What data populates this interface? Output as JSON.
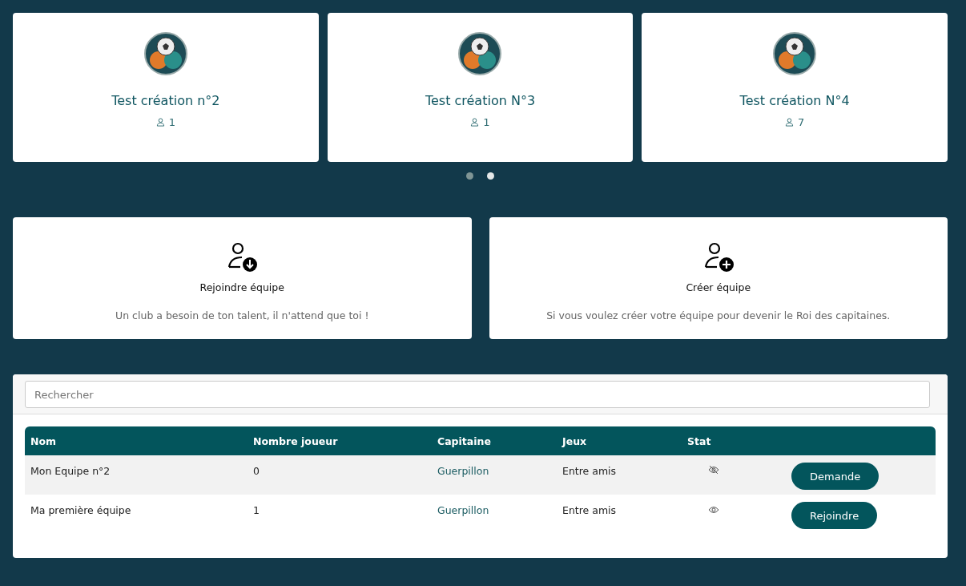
{
  "team_cards": [
    {
      "name": "Test création n°2",
      "members": "1"
    },
    {
      "name": "Test création N°3",
      "members": "1"
    },
    {
      "name": "Test création N°4",
      "members": "7"
    }
  ],
  "carousel_dots": [
    {
      "selected": false
    },
    {
      "selected": true
    }
  ],
  "actions": [
    {
      "kind": "join",
      "title": "Rejoindre équipe",
      "description": "Un club a besoin de ton talent, il n'attend que toi !"
    },
    {
      "kind": "create",
      "title": "Créer équipe",
      "description": "Si vous voulez créer votre équipe pour devenir le Roi des capitaines."
    }
  ],
  "search": {
    "placeholder": "Rechercher"
  },
  "table": {
    "columns": [
      "Nom",
      "Nombre joueur",
      "Capitaine",
      "Jeux",
      "Stat"
    ],
    "rows": [
      {
        "name": "Mon Equipe n°2",
        "players": "0",
        "captain": "Guerpillon",
        "games": "Entre amis",
        "stats_visible": false,
        "action": "Demande"
      },
      {
        "name": "Ma première équipe",
        "players": "1",
        "captain": "Guerpillon",
        "games": "Entre amis",
        "stats_visible": true,
        "action": "Rejoindre"
      }
    ]
  }
}
